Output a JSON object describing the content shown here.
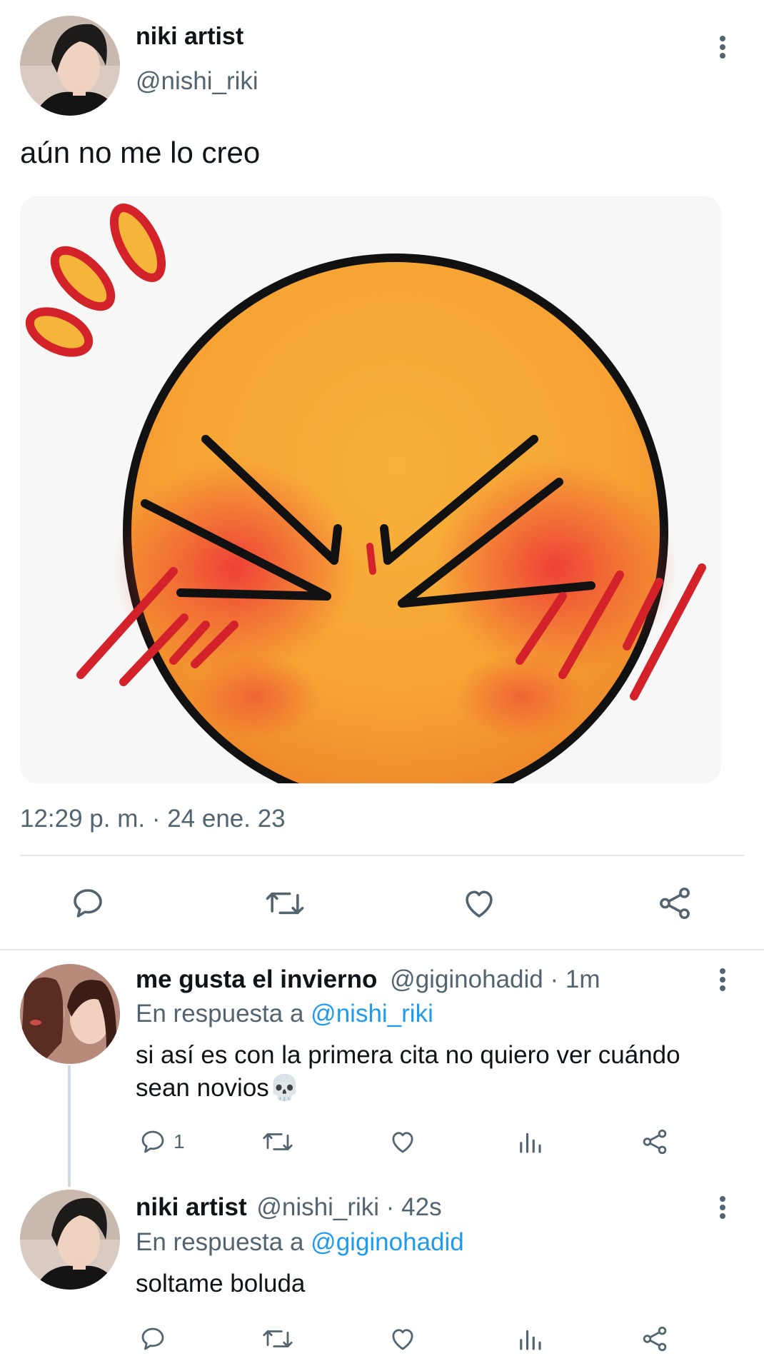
{
  "main_tweet": {
    "author_name": "niki artist",
    "author_handle": "@nishi_riki",
    "text": "aún no me lo creo",
    "timestamp": "12:29 p. m. · 24 ene. 23",
    "image_description_icon": "flustered-emoji"
  },
  "reply_1": {
    "author_name": "me gusta el invierno",
    "author_handle": "@giginohadid",
    "time": "· 1m",
    "in_reply_prefix": "En respuesta a",
    "in_reply_handle": "@nishi_riki",
    "text_line1": "si así es con la primera cita no quiero ver cuándo",
    "text_line2": "sean novios💀",
    "reply_count": "1"
  },
  "reply_2": {
    "author_name": "niki artist",
    "author_handle": "@nishi_riki",
    "time": "· 42s",
    "in_reply_prefix": "En respuesta a",
    "in_reply_handle": "@giginohadid",
    "text": "soltame boluda"
  },
  "colors": {
    "icon": "#536471",
    "link": "#1d9bf0",
    "divider": "#e6e8ea"
  }
}
